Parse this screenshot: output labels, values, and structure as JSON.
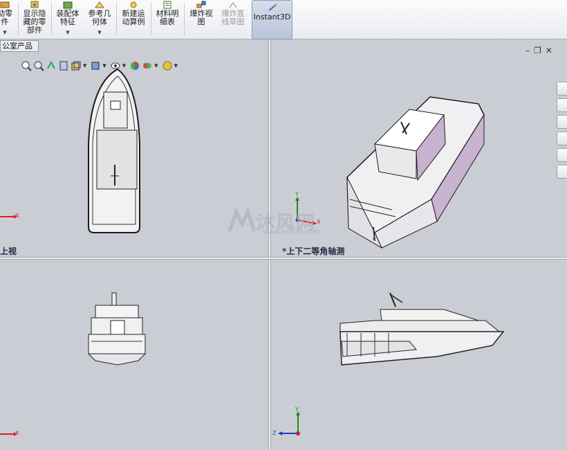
{
  "ribbon": {
    "buttons": [
      {
        "label": "动零\n件",
        "has_dropdown": true
      },
      {
        "label": "显示隐\n藏的零\n部件",
        "has_dropdown": false
      },
      {
        "label": "装配体\n特征",
        "has_dropdown": true
      },
      {
        "label": "参考几\n何体",
        "has_dropdown": true
      },
      {
        "label": "新建运\n动算例",
        "has_dropdown": false
      },
      {
        "label": "材料明\n细表",
        "has_dropdown": false
      },
      {
        "label": "爆炸视\n图",
        "has_dropdown": false
      },
      {
        "label": "爆炸直\n线草图",
        "has_dropdown": false,
        "disabled": true
      }
    ],
    "instant3d_label": "Instant3D"
  },
  "document_tab": "公室产品",
  "viewports": {
    "top_left": {
      "label": "上视"
    },
    "top_right": {
      "label": "*上下二等角轴测"
    },
    "bottom_left": {
      "label": ""
    },
    "bottom_right": {
      "label": ""
    }
  },
  "axes": {
    "x": "X",
    "y": "Y",
    "z": "Z"
  },
  "heads_up_toolbar": [
    "zoom-to-fit-icon",
    "zoom-to-area-icon",
    "previous-view-icon",
    "section-view-icon",
    "view-orientation-icon",
    "display-style-icon",
    "hide-show-items-icon",
    "edit-appearance-icon",
    "apply-scene-icon",
    "view-settings-icon"
  ],
  "task_pane": [
    "home-icon",
    "design-library-icon",
    "file-explorer-icon",
    "view-palette-icon",
    "appearances-icon",
    "custom-properties-icon"
  ],
  "watermark": {
    "text": "沐风网",
    "url": "www.mfcad.com"
  },
  "colors": {
    "viewport_bg": "#cbcdd4",
    "ribbon_bg": "#eef0f3",
    "instant3d_active": "#c3cde0",
    "axis_x": "#d32020",
    "axis_y": "#1f8a1f",
    "axis_z": "#1f3fbf"
  }
}
